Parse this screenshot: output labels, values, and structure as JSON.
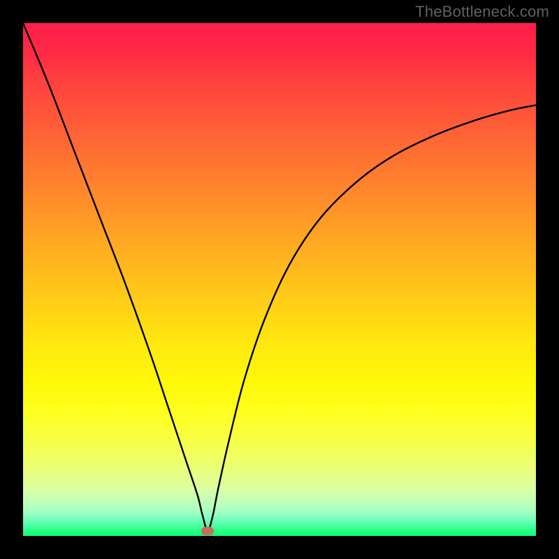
{
  "watermark": "TheBottleneck.com",
  "colors": {
    "frame_bg": "#000000",
    "curve_stroke": "#000000",
    "marker_fill": "#cb6b5f",
    "gradient_top": "#ff1d4a",
    "gradient_bottom": "#0aff70"
  },
  "chart_data": {
    "type": "line",
    "title": "",
    "xlabel": "",
    "ylabel": "",
    "xlim": [
      0,
      100
    ],
    "ylim": [
      0,
      100
    ],
    "grid": false,
    "legend": false,
    "marker": {
      "x": 36,
      "y": 1
    },
    "series": [
      {
        "name": "curve",
        "x": [
          0,
          5,
          10,
          15,
          20,
          25,
          28,
          30,
          32,
          34,
          35,
          36,
          37,
          38,
          40,
          43,
          47,
          52,
          58,
          65,
          72,
          80,
          88,
          95,
          100
        ],
        "y": [
          100,
          88,
          75,
          62,
          49,
          35,
          26,
          20,
          14,
          8,
          4,
          1,
          4,
          9,
          18,
          30,
          42,
          53,
          62,
          69,
          74,
          78,
          81,
          83,
          84
        ]
      }
    ]
  }
}
